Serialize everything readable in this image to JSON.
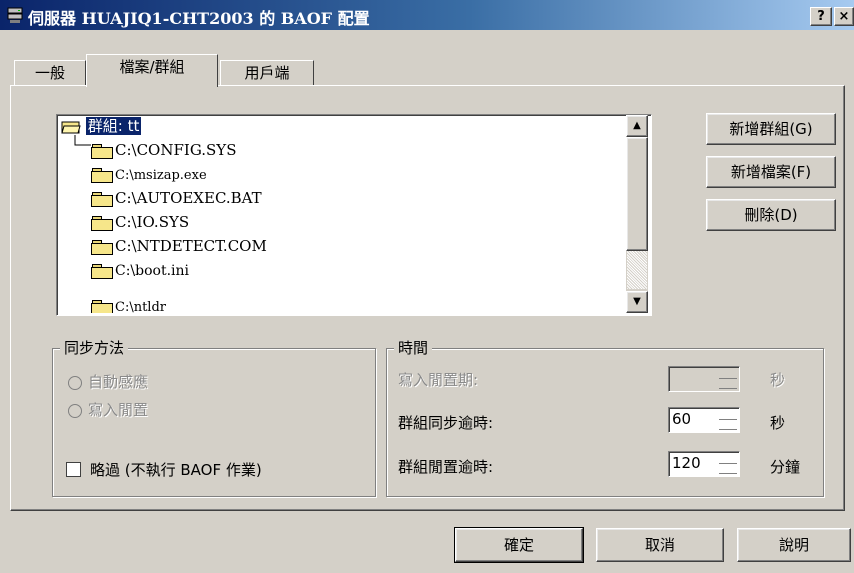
{
  "window": {
    "title": "伺服器 HUAJIQ1-CHT2003 的 BAOF 配置",
    "help_label": "?",
    "close_label": "×"
  },
  "tabs": [
    {
      "label": "一般"
    },
    {
      "label": "檔案/群組",
      "selected": true
    },
    {
      "label": "用戶端"
    }
  ],
  "file_list": {
    "group_label": "群組: tt",
    "items": [
      "C:\\CONFIG.SYS",
      "C:\\msizap.exe",
      "C:\\AUTOEXEC.BAT",
      "C:\\IO.SYS",
      "C:\\NTDETECT.COM",
      "C:\\boot.ini",
      "C:\\ntldr"
    ]
  },
  "buttons": {
    "add_group": "新增群組(G)",
    "add_file": "新增檔案(F)",
    "delete": "刪除(D)"
  },
  "sync_method": {
    "title": "同步方法",
    "option_auto": "自動感應",
    "option_write_idle": "寫入閒置",
    "skip_label": "略過 (不執行 BAOF 作業)"
  },
  "timing": {
    "title": "時間",
    "write_idle_label": "寫入閒置期:",
    "write_idle_value": "",
    "write_idle_unit": "秒",
    "sync_timeout_label": "群組同步逾時:",
    "sync_timeout_value": "60",
    "sync_timeout_unit": "秒",
    "idle_timeout_label": "群組閒置逾時:",
    "idle_timeout_value": "120",
    "idle_timeout_unit": "分鐘"
  },
  "footer": {
    "ok": "確定",
    "cancel": "取消",
    "help": "說明"
  },
  "colors": {
    "title_bar": "#0a246a",
    "selection": "#0a246a",
    "face": "#d4d0c8"
  }
}
